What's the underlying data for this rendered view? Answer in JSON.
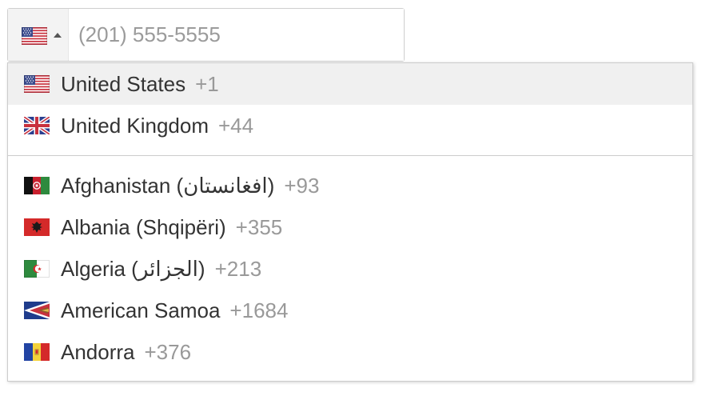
{
  "phone_input": {
    "placeholder": "(201) 555-5555",
    "selected_flag": "us-flag-icon"
  },
  "preferred_countries": [
    {
      "name": "United States",
      "dial": "+1",
      "flag": "us-flag-icon",
      "highlighted": true
    },
    {
      "name": "United Kingdom",
      "dial": "+44",
      "flag": "gb-flag-icon",
      "highlighted": false
    }
  ],
  "countries": [
    {
      "name": "Afghanistan (افغانستان)",
      "dial": "+93",
      "flag": "af-flag-icon"
    },
    {
      "name": "Albania (Shqipëri)",
      "dial": "+355",
      "flag": "al-flag-icon"
    },
    {
      "name": "Algeria (الجزائر)",
      "dial": "+213",
      "flag": "dz-flag-icon"
    },
    {
      "name": "American Samoa",
      "dial": "+1684",
      "flag": "as-flag-icon"
    },
    {
      "name": "Andorra",
      "dial": "+376",
      "flag": "ad-flag-icon"
    }
  ],
  "colors": {
    "highlight_bg": "#f0f0f0",
    "dial_code": "#999999",
    "border": "#cccccc"
  }
}
